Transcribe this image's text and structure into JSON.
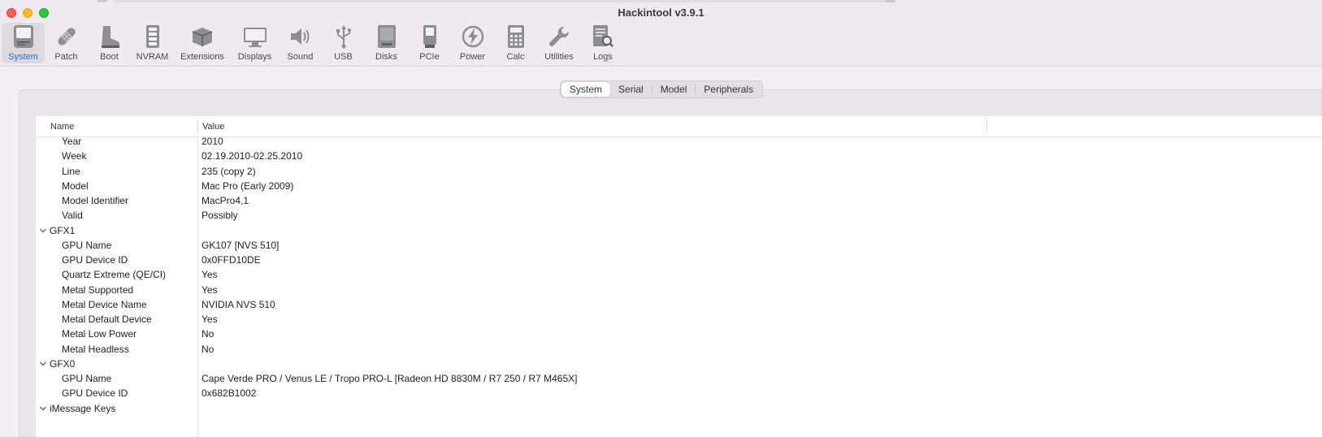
{
  "window": {
    "title": "Hackintool v3.9.1"
  },
  "toolbar": {
    "items": [
      {
        "label": "System",
        "icon": "computer-icon"
      },
      {
        "label": "Patch",
        "icon": "bandage-icon"
      },
      {
        "label": "Boot",
        "icon": "boot-icon"
      },
      {
        "label": "NVRAM",
        "icon": "memory-icon"
      },
      {
        "label": "Extensions",
        "icon": "box-icon"
      },
      {
        "label": "Displays",
        "icon": "display-icon"
      },
      {
        "label": "Sound",
        "icon": "speaker-icon"
      },
      {
        "label": "USB",
        "icon": "usb-icon"
      },
      {
        "label": "Disks",
        "icon": "disk-icon"
      },
      {
        "label": "PCIe",
        "icon": "pcie-card-icon"
      },
      {
        "label": "Power",
        "icon": "power-bolt-icon"
      },
      {
        "label": "Calc",
        "icon": "calculator-icon"
      },
      {
        "label": "Utilities",
        "icon": "wrench-icon"
      },
      {
        "label": "Logs",
        "icon": "log-search-icon"
      }
    ],
    "selected": "System"
  },
  "tabs": {
    "items": [
      "System",
      "Serial",
      "Model",
      "Peripherals"
    ],
    "selected": "System"
  },
  "table": {
    "headers": {
      "name": "Name",
      "value": "Value"
    },
    "rows": [
      {
        "name": "Year",
        "value": "2010"
      },
      {
        "name": "Week",
        "value": "02.19.2010-02.25.2010"
      },
      {
        "name": "Line",
        "value": "235 (copy 2)"
      },
      {
        "name": "Model",
        "value": "Mac Pro (Early 2009)"
      },
      {
        "name": "Model Identifier",
        "value": "MacPro4,1"
      },
      {
        "name": "Valid",
        "value": "Possibly"
      },
      {
        "name": "GFX1",
        "value": "",
        "group": true
      },
      {
        "name": "GPU Name",
        "value": "GK107 [NVS 510]"
      },
      {
        "name": "GPU Device ID",
        "value": "0x0FFD10DE"
      },
      {
        "name": "Quartz Extreme (QE/CI)",
        "value": "Yes"
      },
      {
        "name": "Metal Supported",
        "value": "Yes"
      },
      {
        "name": "Metal Device Name",
        "value": "NVIDIA NVS 510"
      },
      {
        "name": "Metal Default Device",
        "value": "Yes"
      },
      {
        "name": "Metal Low Power",
        "value": "No"
      },
      {
        "name": "Metal Headless",
        "value": "No"
      },
      {
        "name": "GFX0",
        "value": "",
        "group": true
      },
      {
        "name": "GPU Name",
        "value": "Cape Verde PRO / Venus LE / Tropo PRO-L [Radeon HD 8830M / R7 250 / R7 M465X]"
      },
      {
        "name": "GPU Device ID",
        "value": "0x682B1002"
      },
      {
        "name": "iMessage Keys",
        "value": "",
        "group": true
      }
    ]
  },
  "colors": {
    "accent": "#1f6fd6",
    "close": "#ff5f57",
    "minimize": "#febc2e",
    "zoom": "#28c840"
  }
}
